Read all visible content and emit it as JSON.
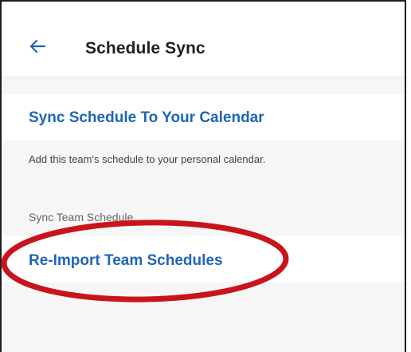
{
  "header": {
    "title": "Schedule Sync",
    "back_icon": "arrow-left-icon"
  },
  "sync_calendar": {
    "label": "Sync Schedule To Your Calendar",
    "description": "Add this team's schedule to your personal calendar."
  },
  "team_sync": {
    "section_label": "Sync Team Schedule",
    "reimport_label": "Re-Import Team Schedules"
  },
  "colors": {
    "accent": "#1f65b8",
    "annotation": "#c8141c",
    "background": "#f6f6f6"
  },
  "annotation": {
    "type": "red-ellipse",
    "target": "Re-Import Team Schedules"
  }
}
